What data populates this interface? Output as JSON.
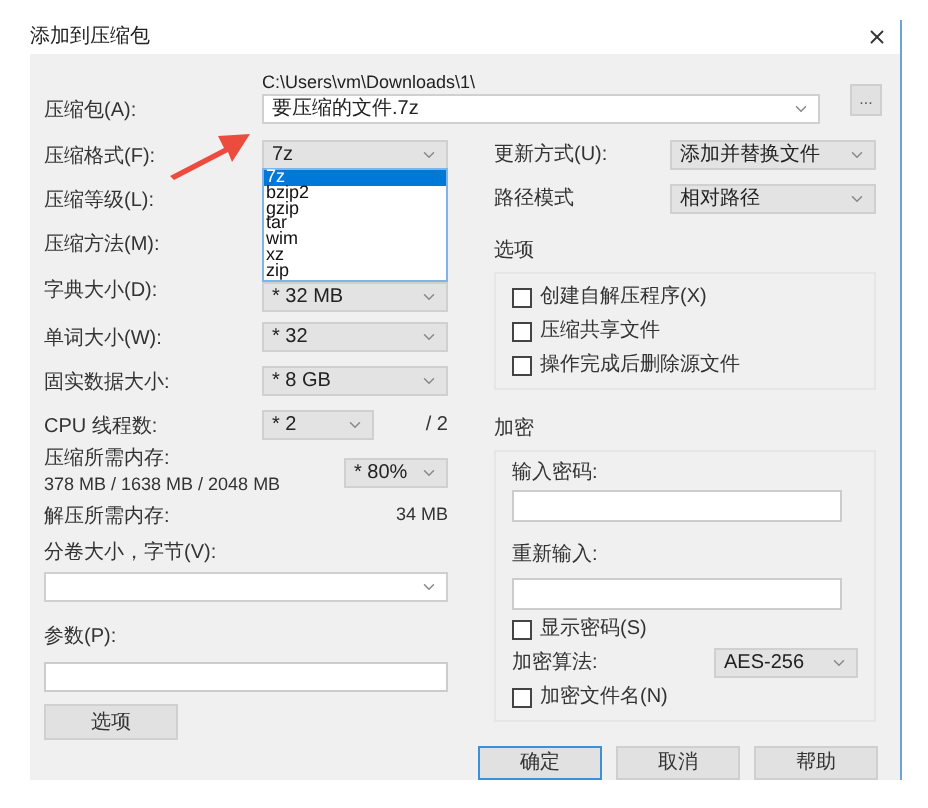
{
  "window": {
    "title": "添加到压缩包"
  },
  "archive": {
    "label": "压缩包(A):",
    "path": "C:\\Users\\vm\\Downloads\\1\\",
    "filename": "要压缩的文件.7z",
    "browse": "..."
  },
  "format": {
    "label": "压缩格式(F):",
    "value": "7z",
    "options": [
      {
        "label": "7z",
        "selected": true
      },
      {
        "label": "bzip2",
        "selected": false
      },
      {
        "label": "gzip",
        "selected": false
      },
      {
        "label": "tar",
        "selected": false
      },
      {
        "label": "wim",
        "selected": false
      },
      {
        "label": "xz",
        "selected": false
      },
      {
        "label": "zip",
        "selected": false
      }
    ]
  },
  "settings": [
    {
      "kind": "combo",
      "label": "压缩等级(L):"
    },
    {
      "kind": "combo",
      "label": "压缩方法(M):"
    },
    {
      "kind": "combo",
      "label": "字典大小(D):",
      "value": "* 32 MB"
    },
    {
      "kind": "combo",
      "label": "单词大小(W):",
      "value": "* 32"
    },
    {
      "kind": "combo",
      "label": "固实数据大小:",
      "value": "* 8 GB"
    },
    {
      "kind": "cpu",
      "label": "CPU 线程数:",
      "value": "* 2",
      "suffix": "/ 2"
    },
    {
      "kind": "memory",
      "label": "压缩所需内存:",
      "detail": "378 MB / 1638 MB / 2048 MB",
      "value": "* 80%"
    },
    {
      "kind": "readout",
      "label": "解压所需内存:",
      "value": "34 MB"
    }
  ],
  "volume": {
    "label": "分卷大小，字节(V):"
  },
  "parameters": {
    "label": "参数(P):"
  },
  "options_button": "选项",
  "update_mode": {
    "label": "更新方式(U):",
    "value": "添加并替换文件"
  },
  "path_mode": {
    "label": "路径模式",
    "value": "相对路径"
  },
  "options_group": {
    "title": "选项",
    "checkboxes": [
      {
        "label": "创建自解压程序(X)",
        "checked": false
      },
      {
        "label": "压缩共享文件",
        "checked": false
      },
      {
        "label": "操作完成后删除源文件",
        "checked": false
      }
    ]
  },
  "encryption": {
    "title": "加密",
    "password_label": "输入密码:",
    "reenter_label": "重新输入:",
    "show_password": {
      "label": "显示密码(S)",
      "checked": false
    },
    "method_label": "加密算法:",
    "method_value": "AES-256",
    "encrypt_names": {
      "label": "加密文件名(N)",
      "checked": false
    }
  },
  "buttons": [
    {
      "label": "确定",
      "default": true
    },
    {
      "label": "取消",
      "default": false
    },
    {
      "label": "帮助",
      "default": false
    }
  ]
}
